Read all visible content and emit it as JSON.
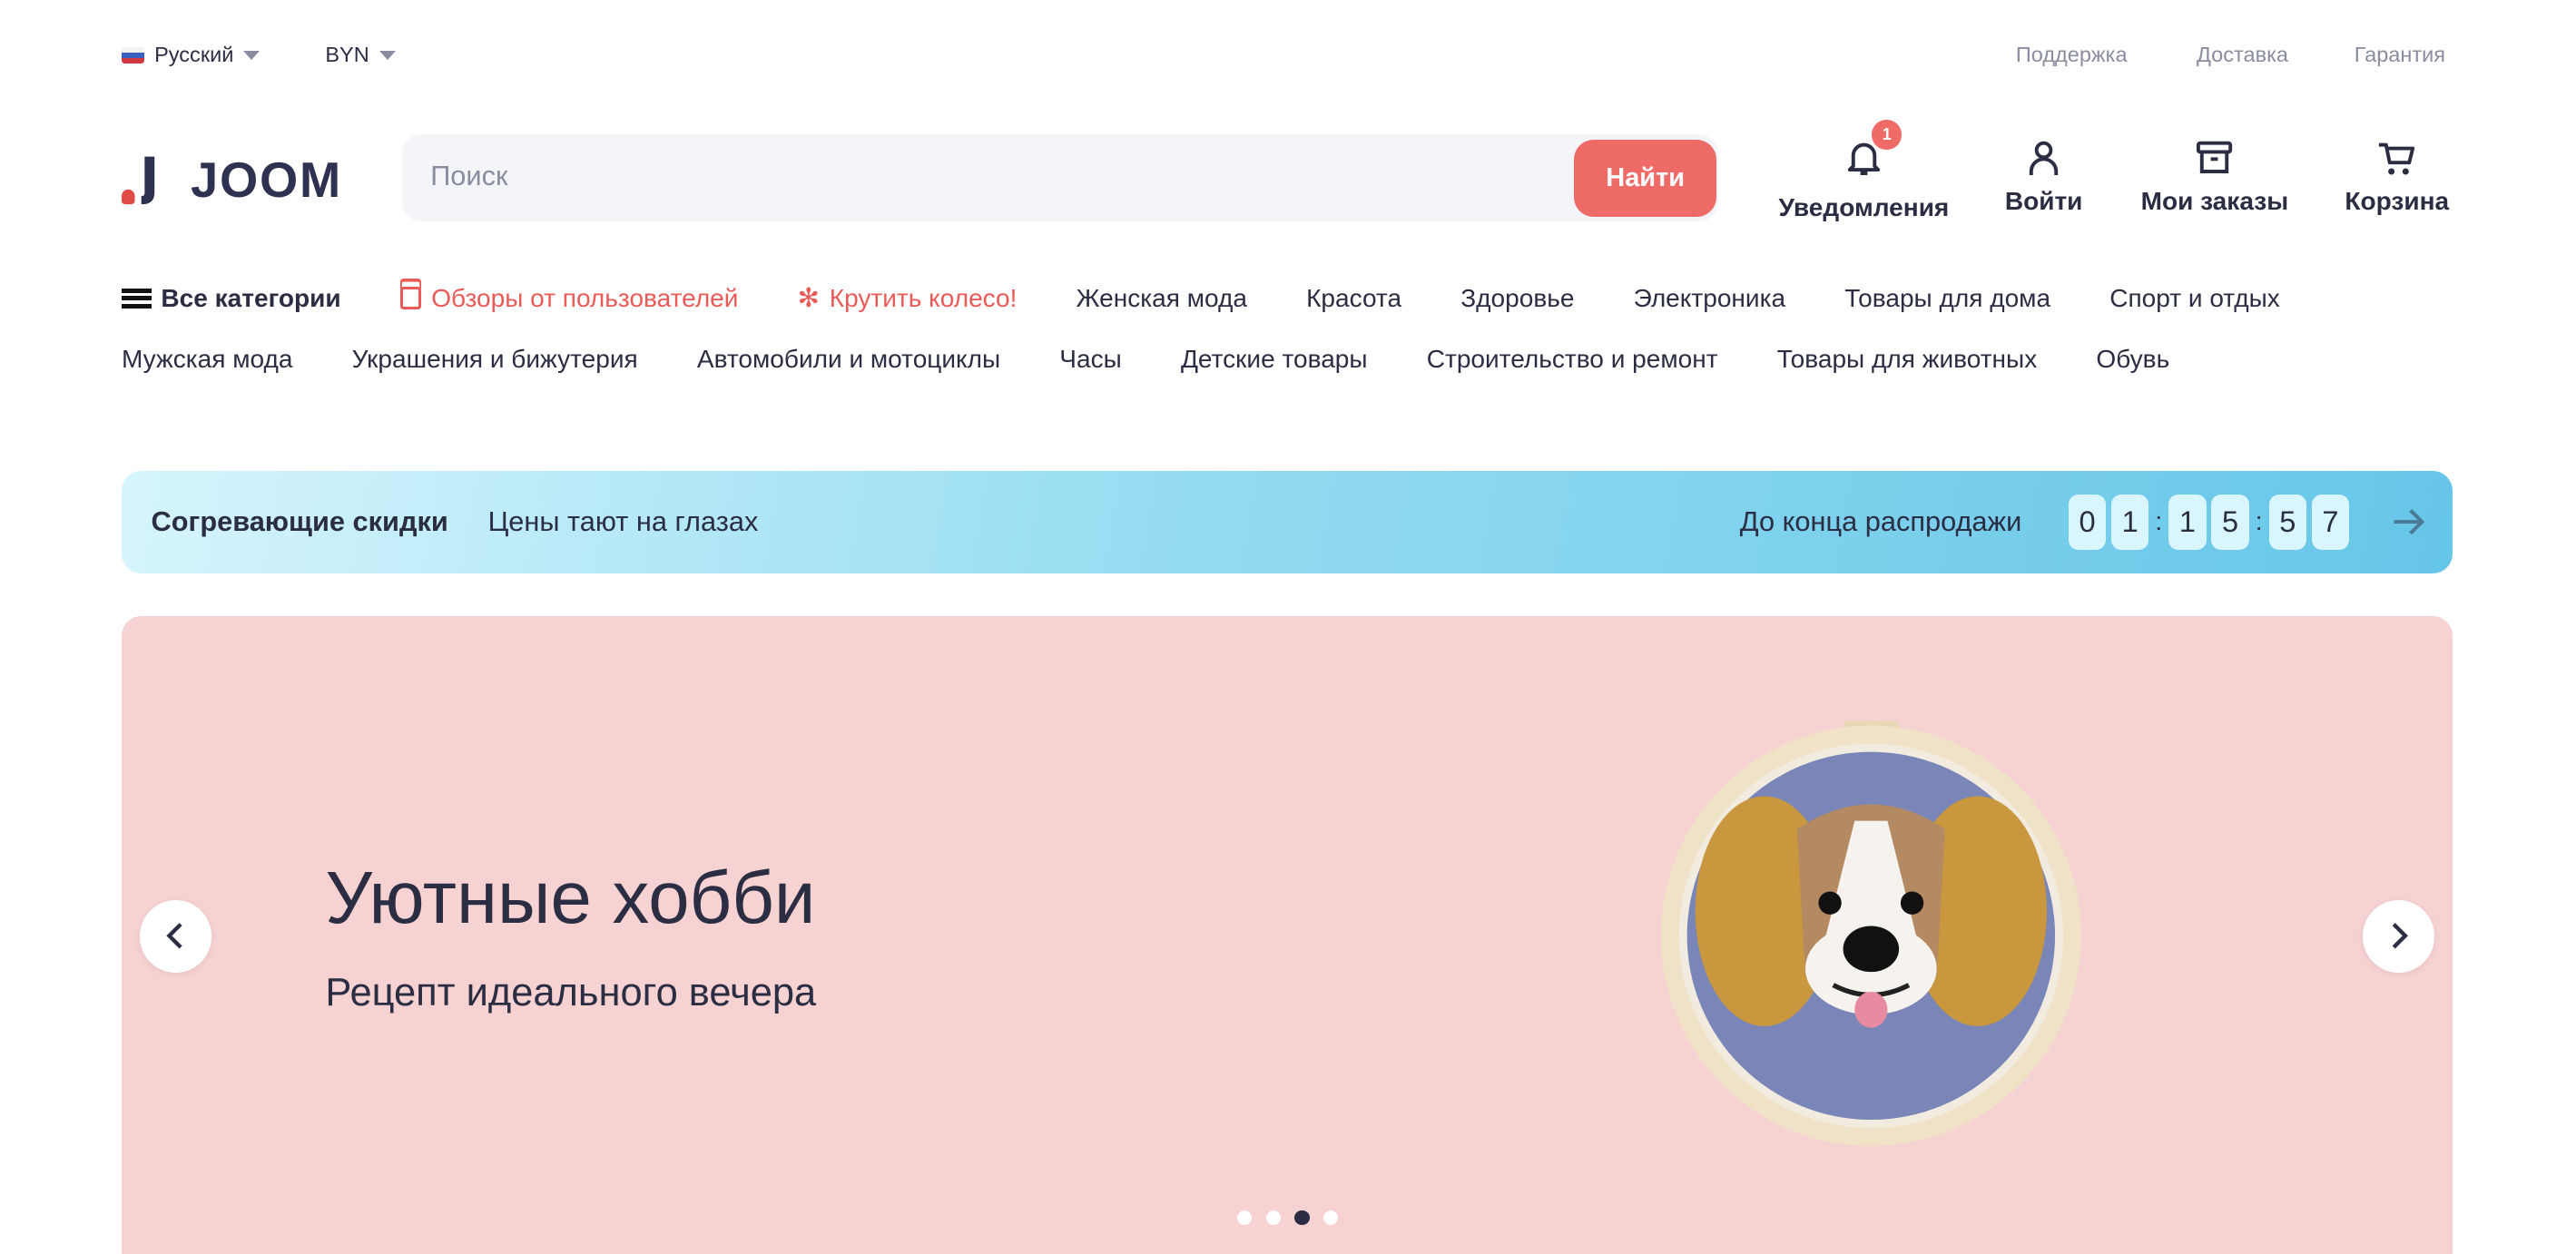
{
  "topbar": {
    "language": "Русский",
    "currency": "BYN",
    "links": [
      "Поддержка",
      "Доставка",
      "Гарантия"
    ]
  },
  "logo": "JOOM",
  "search": {
    "placeholder": "Поиск",
    "value": "",
    "button": "Найти"
  },
  "header_actions": [
    {
      "label": "Уведомления",
      "icon": "bell-icon",
      "badge": "1"
    },
    {
      "label": "Войти",
      "icon": "user-icon"
    },
    {
      "label": "Мои заказы",
      "icon": "orders-box-icon"
    },
    {
      "label": "Корзина",
      "icon": "cart-icon"
    }
  ],
  "categories": {
    "all": "Все категории",
    "reviews": "Обзоры от пользователей",
    "wheel": "Крутить колесо!",
    "row1": [
      "Женская мода",
      "Красота",
      "Здоровье",
      "Электроника",
      "Товары для дома",
      "Спорт и отдых"
    ],
    "row2": [
      "Мужская мода",
      "Украшения и бижутерия",
      "Автомобили и мотоциклы",
      "Часы",
      "Детские товары",
      "Строительство и ремонт",
      "Товары для животных",
      "Обувь"
    ]
  },
  "sale_banner": {
    "title": "Согревающие скидки",
    "subtitle": "Цены тают на глазах",
    "countdown_label": "До конца распродажи",
    "countdown": [
      "0",
      "1",
      "1",
      "5",
      "5",
      "7"
    ]
  },
  "hero": {
    "title": "Уютные хобби",
    "subtitle": "Рецепт идеального вечера",
    "slides_total": 4,
    "active_slide": 3
  },
  "colors": {
    "accent": "#ef6b68",
    "text": "#2b2d42",
    "hero_bg": "#f7d2d2",
    "sale_gradient_end": "#66c6e8"
  }
}
